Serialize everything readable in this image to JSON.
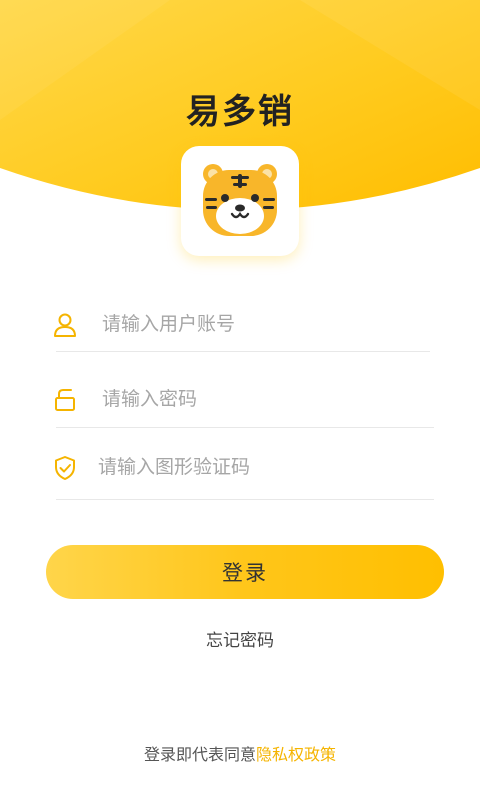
{
  "app": {
    "title": "易多销"
  },
  "form": {
    "account_placeholder": "请输入用户账号",
    "password_placeholder": "请输入密码",
    "captcha_placeholder": "请输入图形验证码"
  },
  "actions": {
    "login_label": "登录",
    "forgot_password_label": "忘记密码"
  },
  "footer": {
    "agreement_prefix": "登录即代表同意",
    "privacy_link_label": "隐私权政策"
  },
  "icons": {
    "account": "user-icon",
    "password": "lock-icon",
    "captcha": "shield-check-icon",
    "logo": "tiger-logo-icon"
  },
  "colors": {
    "brand_yellow": "#ffc61a",
    "icon_yellow": "#f5b400",
    "text_dark": "#222222",
    "placeholder": "#a6a6a6",
    "link": "#f5b400"
  }
}
